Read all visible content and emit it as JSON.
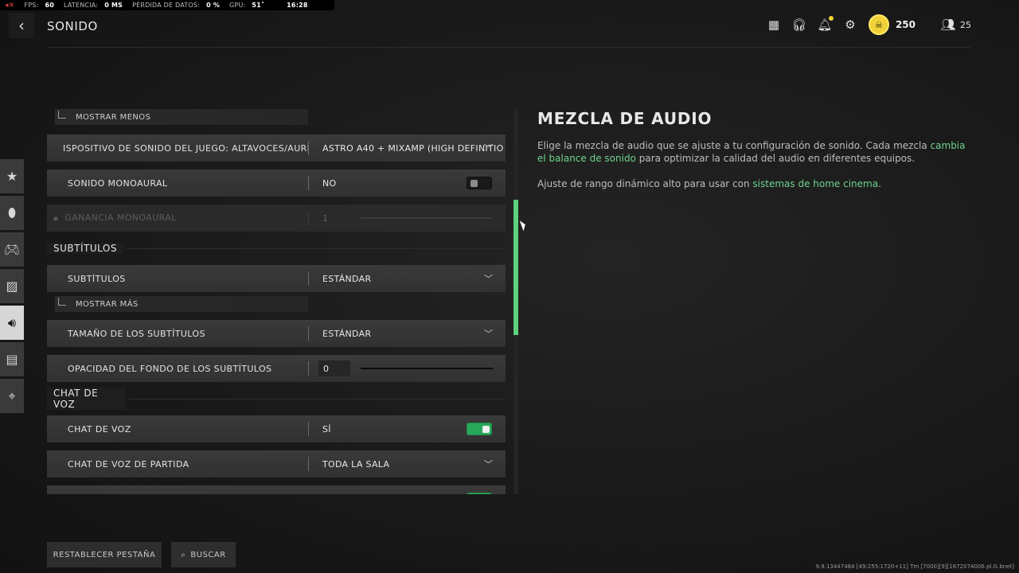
{
  "telemetry": {
    "fps_label": "FPS:",
    "fps_value": "60",
    "latency_label": "LATENCIA:",
    "latency_value": "0 MS",
    "loss_label": "PÉRDIDA DE DATOS:",
    "loss_value": "0 %",
    "gpu_label": "GPU:",
    "gpu_value": "51˚",
    "clock": "16:28"
  },
  "header": {
    "title": "SONIDO",
    "rank_value": "250",
    "players_value": "25",
    "icons": [
      "grid-icon",
      "headset-icon",
      "bell-icon",
      "gear-icon",
      "rank-badge-icon",
      "friends-icon"
    ]
  },
  "sidebar": {
    "items": [
      {
        "name": "star-icon",
        "active": false
      },
      {
        "name": "mouse-icon",
        "active": false
      },
      {
        "name": "controller-icon",
        "active": false
      },
      {
        "name": "display-icon",
        "active": false
      },
      {
        "name": "speaker-icon",
        "active": true
      },
      {
        "name": "interface-icon",
        "active": false
      },
      {
        "name": "network-icon",
        "active": false
      }
    ]
  },
  "settings": {
    "show_less": "MOSTRAR MENOS",
    "device_label": "ISPOSITIVO DE SONIDO DEL JUEGO: ALTAVOCES/AURICULA",
    "device_value": "ASTRO A40 + MIXAMP (HIGH DEFINITIO",
    "mono_label": "SONIDO MONOAURAL",
    "mono_value": "NO",
    "mono_gain_label": "GANANCIA MONOAURAL",
    "mono_gain_value": "1",
    "mono_gain_level": 0,
    "subtitles_section": "SUBTÍTULOS",
    "subtitles_label": "SUBTÍTULOS",
    "subtitles_value": "ESTÁNDAR",
    "show_more": "MOSTRAR MÁS",
    "subtitle_size_label": "TAMAÑO DE LOS SUBTÍTULOS",
    "subtitle_size_value": "ESTÁNDAR",
    "subtitle_bg_label": "OPACIDAD DEL FONDO DE LOS SUBTÍTULOS",
    "subtitle_bg_value": "0",
    "subtitle_bg_level": 0,
    "voice_section": "CHAT DE VOZ",
    "voice_label": "CHAT DE VOZ",
    "voice_value": "SÍ",
    "match_voice_label": "CHAT DE VOZ DE PARTIDA",
    "match_voice_value": "TODA LA SALA"
  },
  "description": {
    "title": "MEZCLA DE AUDIO",
    "p1_a": "Elige la mezcla de audio que se ajuste a tu configuración de sonido. Cada mezcla ",
    "p1_hl": "cambia el balance de sonido",
    "p1_b": " para optimizar la calidad del audio en diferentes equipos.",
    "p2_a": "Ajuste de rango dinámico alto para usar con ",
    "p2_hl": "sistemas de home cinema",
    "p2_b": "."
  },
  "footer": {
    "reset_label": "RESTABLECER PESTAÑA",
    "search_label": "BUSCAR",
    "build": "9.9.13447484 [49:255:1720+11] Tm [7000][9][1672074006.pl.G.bnet]"
  },
  "colors": {
    "accent_green": "#6ed38b",
    "toggle_on": "#27a85a",
    "rank_gold": "#f0d238",
    "alert_red": "#e04444"
  }
}
